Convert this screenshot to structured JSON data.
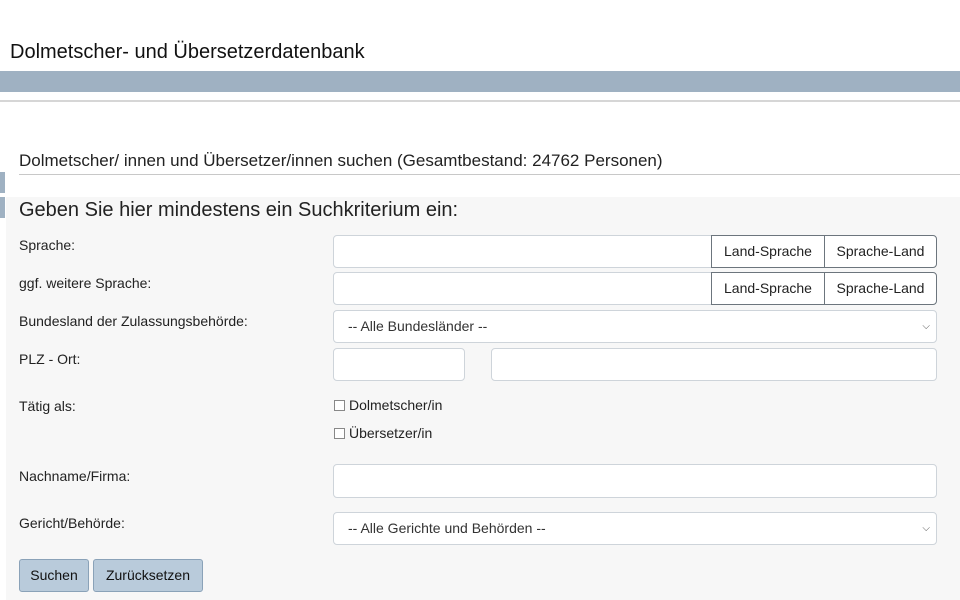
{
  "header": {
    "title": "Dolmetscher- und Übersetzerdatenbank"
  },
  "panel": {
    "title": "Dolmetscher/ innen und Übersetzer/innen suchen (Gesamtbestand: 24762 Personen)"
  },
  "form": {
    "heading": "Geben Sie hier mindestens ein Suchkriterium ein:",
    "language": {
      "label": "Sprache:",
      "value": "",
      "btn_country_language": "Land-Sprache",
      "btn_language_country": "Sprache-Land"
    },
    "language2": {
      "label": "ggf. weitere Sprache:",
      "value": "",
      "btn_country_language": "Land-Sprache",
      "btn_language_country": "Sprache-Land"
    },
    "state": {
      "label": "Bundesland der Zulassungsbehörde:",
      "selected": "-- Alle Bundesländer --"
    },
    "plz": {
      "label": "PLZ - Ort:",
      "zip_value": "",
      "city_value": ""
    },
    "role": {
      "label": "Tätig als:",
      "options": [
        {
          "label": "Dolmetscher/in",
          "checked": false
        },
        {
          "label": "Übersetzer/in",
          "checked": false
        }
      ]
    },
    "name": {
      "label": "Nachname/Firma:",
      "value": ""
    },
    "court": {
      "label": "Gericht/Behörde:",
      "selected": "-- Alle Gerichte und Behörden --"
    },
    "submit_label": "Suchen",
    "reset_label": "Zurücksetzen"
  },
  "icons": {
    "select_chevron": "chevron-down-icon",
    "checkbox": "checkbox-icon"
  },
  "colors": {
    "header_bar": "#9fb1c2",
    "primary_button": "#b9cbdb",
    "form_background": "#f7f7f7"
  }
}
